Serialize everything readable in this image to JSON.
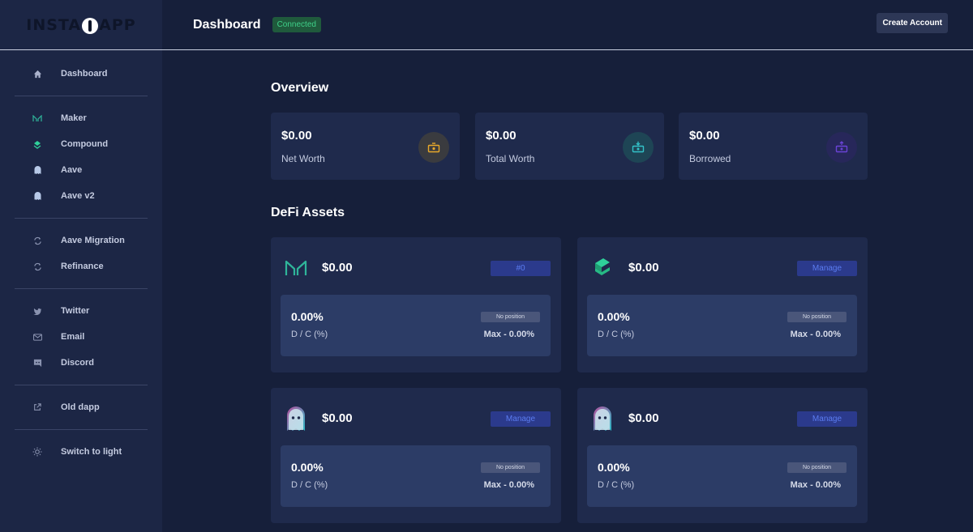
{
  "brand": {
    "logo_left": "INSTA",
    "logo_right": "APP"
  },
  "sidebar": {
    "items": [
      {
        "label": "Dashboard",
        "icon": "home-icon"
      },
      {
        "label": "Maker",
        "icon": "maker-icon"
      },
      {
        "label": "Compound",
        "icon": "compound-icon"
      },
      {
        "label": "Aave",
        "icon": "aave-ghost-icon"
      },
      {
        "label": "Aave v2",
        "icon": "aave-ghost-icon"
      },
      {
        "label": "Aave Migration",
        "icon": "migration-icon"
      },
      {
        "label": "Refinance",
        "icon": "refinance-icon"
      },
      {
        "label": "Twitter",
        "icon": "twitter-icon"
      },
      {
        "label": "Email",
        "icon": "email-icon"
      },
      {
        "label": "Discord",
        "icon": "discord-icon"
      },
      {
        "label": "Old dapp",
        "icon": "external-link-icon"
      },
      {
        "label": "Switch to light",
        "icon": "sun-icon"
      }
    ]
  },
  "header": {
    "title": "Dashboard",
    "status": "Connected",
    "create_account": "Create Account"
  },
  "overview": {
    "title": "Overview",
    "cards": [
      {
        "value": "$0.00",
        "label": "Net Worth",
        "icon": "net-worth-icon",
        "color": "#e8a92a"
      },
      {
        "value": "$0.00",
        "label": "Total Worth",
        "icon": "total-worth-icon",
        "color": "#33c3c9"
      },
      {
        "value": "$0.00",
        "label": "Borrowed",
        "icon": "borrowed-icon",
        "color": "#6a43d6"
      }
    ]
  },
  "defi": {
    "title": "DeFi Assets",
    "assets": [
      {
        "value": "$0.00",
        "button": "#0",
        "pct": "0.00%",
        "dc_label": "D / C (%)",
        "status": "No position",
        "max": "Max - 0.00%",
        "icon": "maker-logo-icon"
      },
      {
        "value": "$0.00",
        "button": "Manage",
        "pct": "0.00%",
        "dc_label": "D / C (%)",
        "status": "No position",
        "max": "Max - 0.00%",
        "icon": "compound-logo-icon"
      },
      {
        "value": "$0.00",
        "button": "Manage",
        "pct": "0.00%",
        "dc_label": "D / C (%)",
        "status": "No position",
        "max": "Max - 0.00%",
        "icon": "aave-ghost-logo-icon"
      },
      {
        "value": "$0.00",
        "button": "Manage",
        "pct": "0.00%",
        "dc_label": "D / C (%)",
        "status": "No position",
        "max": "Max - 0.00%",
        "icon": "aave-ghost-logo-icon"
      }
    ]
  },
  "colors": {
    "background": "#161f3a",
    "sidebar": "#1c2645",
    "card": "#1f2a4c",
    "accent_button": "#2b3a8c",
    "connected": "#3fd089"
  }
}
